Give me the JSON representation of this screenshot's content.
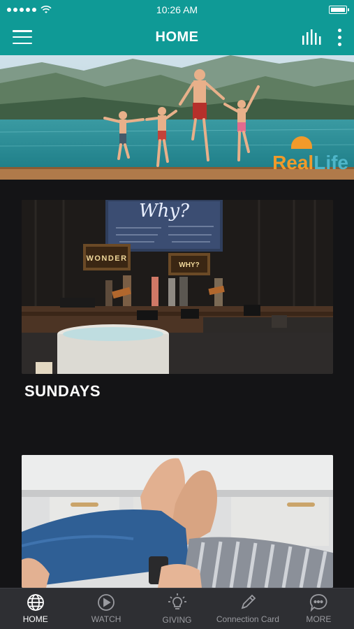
{
  "status_bar": {
    "time": "10:26 AM"
  },
  "header": {
    "title": "HOME"
  },
  "hero": {
    "logo_real": "Real",
    "logo_life": "Life"
  },
  "cards": [
    {
      "title": "SUNDAYS",
      "sign_left": "WONDER",
      "sign_right": "WHY?",
      "screen_text": "Why?"
    },
    {
      "title": ""
    }
  ],
  "bottom_nav": [
    {
      "label": "HOME",
      "icon": "globe-icon",
      "active": true
    },
    {
      "label": "WATCH",
      "icon": "play-icon",
      "active": false
    },
    {
      "label": "GIVING",
      "icon": "lightbulb-icon",
      "active": false
    },
    {
      "label": "Connection Card",
      "icon": "pencil-icon",
      "active": false
    },
    {
      "label": "MORE",
      "icon": "chat-bubble-icon",
      "active": false
    }
  ],
  "colors": {
    "brand": "#0f9a96",
    "background": "#141416",
    "nav": "#2e2f33",
    "logo_orange": "#f19a2a",
    "logo_blue": "#4fb6c9"
  }
}
